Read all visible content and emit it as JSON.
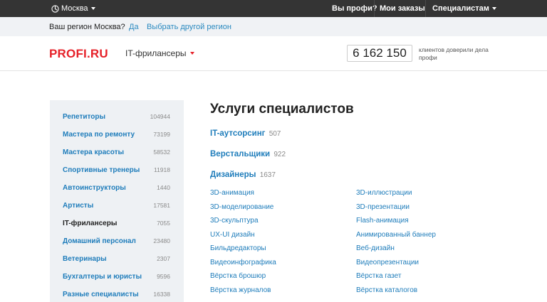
{
  "topbar": {
    "city": "Москва",
    "nav": [
      "Вы профи?",
      "Мои заказы",
      "Специалистам"
    ]
  },
  "region": {
    "question": "Ваш регион Москва?",
    "yes": "Да",
    "other": "Выбрать другой регион"
  },
  "header": {
    "logo": "PROFI.RU",
    "category": "IT-фрилансеры",
    "counter": "6 162 150",
    "counter_note": "клиентов доверили дела профи"
  },
  "sidebar": {
    "items": [
      {
        "label": "Репетиторы",
        "count": "104944"
      },
      {
        "label": "Мастера по ремонту",
        "count": "73199"
      },
      {
        "label": "Мастера красоты",
        "count": "58532"
      },
      {
        "label": "Спортивные тренеры",
        "count": "11918"
      },
      {
        "label": "Автоинструкторы",
        "count": "1440"
      },
      {
        "label": "Артисты",
        "count": "17581"
      },
      {
        "label": "IT-фрилансеры",
        "count": "7055"
      },
      {
        "label": "Домашний персонал",
        "count": "23480"
      },
      {
        "label": "Ветеринары",
        "count": "2307"
      },
      {
        "label": "Бухгалтеры и юристы",
        "count": "9596"
      },
      {
        "label": "Разные специалисты",
        "count": "16338"
      }
    ]
  },
  "main": {
    "title": "Услуги специалистов",
    "groups": [
      {
        "name": "IT-аутсорсинг",
        "count": "507"
      },
      {
        "name": "Верстальщики",
        "count": "922"
      },
      {
        "name": "Дизайнеры",
        "count": "1637"
      }
    ],
    "services_left": [
      "3D-анимация",
      "3D-моделирование",
      "3D-скульптура",
      "UX-UI дизайн",
      "Бильдредакторы",
      "Видеоинфографика",
      "Вёрстка брошюр",
      "Вёрстка журналов"
    ],
    "services_right": [
      "3D-иллюстрации",
      "3D-презентации",
      "Flash-анимация",
      "Анимированный баннер",
      "Веб-дизайн",
      "Видеопрезентации",
      "Вёрстка газет",
      "Вёрстка каталогов"
    ]
  }
}
